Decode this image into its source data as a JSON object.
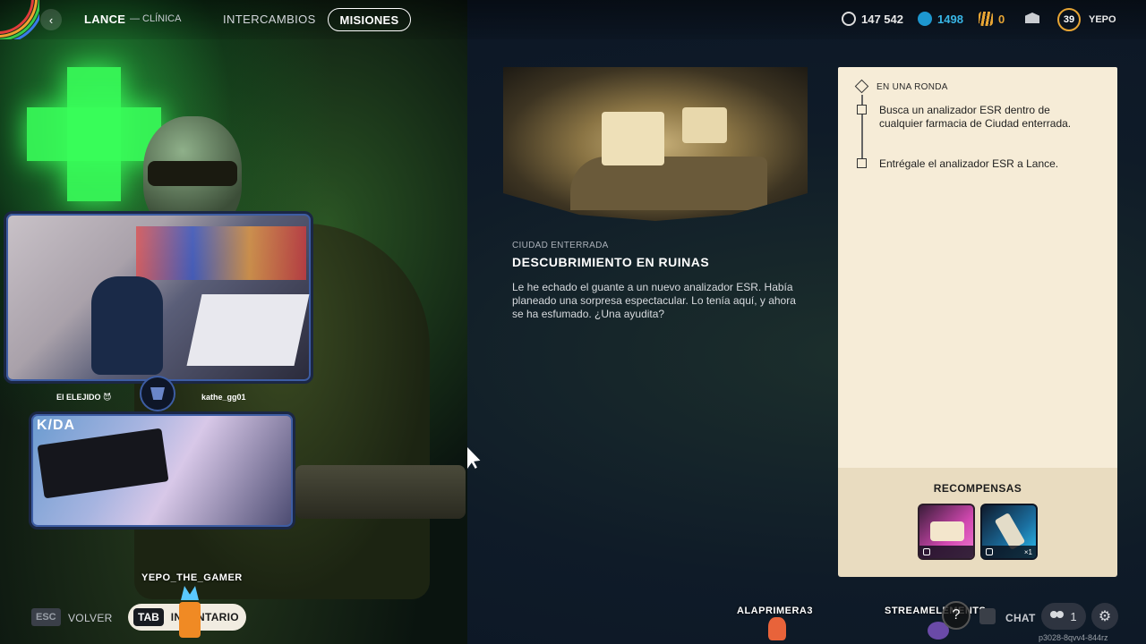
{
  "header": {
    "npc_name": "LANCE",
    "npc_location": "— CLÍNICA",
    "tab_trades": "INTERCAMBIOS",
    "tab_missions": "MISIONES",
    "back_icon": "‹"
  },
  "currencies": {
    "coins": "147 542",
    "tokens": "1498",
    "other": "0"
  },
  "player": {
    "level": "39",
    "name": "YEPO"
  },
  "stream": {
    "cam_label_left": "El ELEJIDO 😈",
    "cam_label_right": "kathe_gg01",
    "cam2_overlay": "K/DA",
    "streamer_tag": "YEPO_THE_GAMER",
    "viewer_a": "ALAPRIMERA3",
    "viewer_b": "STREAMELEMENTS"
  },
  "mission": {
    "location": "CIUDAD ENTERRADA",
    "title": "DESCUBRIMIENTO EN RUINAS",
    "description": "Le he echado el guante a un nuevo analizador ESR. Había planeado una sorpresa espectacular. Lo tenía aquí, y ahora se ha esfumado. ¿Una ayudita?"
  },
  "objectives": {
    "header": "EN UNA RONDA",
    "items": [
      "Busca un analizador ESR dentro de cualquier farmacia de Ciudad enterrada.",
      "Entrégale el analizador ESR a Lance."
    ]
  },
  "rewards": {
    "title": "RECOMPENSAS",
    "items": [
      {
        "qty": ""
      },
      {
        "qty": "×1"
      }
    ]
  },
  "footer": {
    "esc_key": "ESC",
    "back_label": "VOLVER",
    "tab_key": "TAB",
    "inventory_label": "INVENTARIO",
    "help_glyph": "?",
    "chat_label": "CHAT",
    "party_count": "1",
    "settings_glyph": "⚙",
    "session_id": "p3028-8qvv4-844rz"
  },
  "colors": {
    "accent_gold": "#e7a534",
    "token_blue": "#38b6e6",
    "panel_cream": "#f6ecd7",
    "rewards_beige": "#e9dcc0"
  }
}
